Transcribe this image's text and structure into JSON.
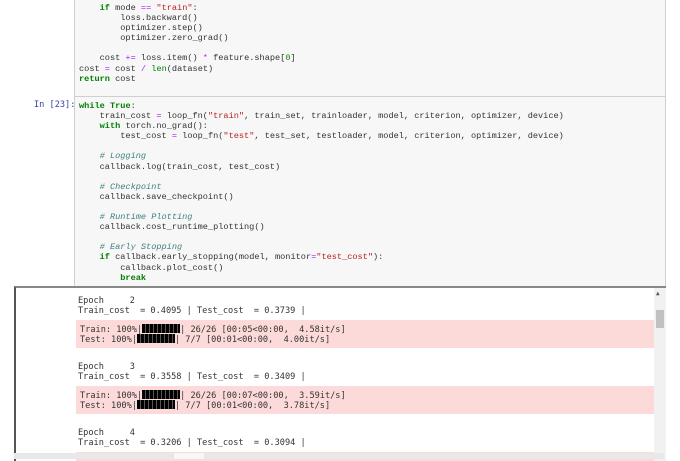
{
  "cell1": {
    "lines": [
      [
        [
          "    ",
          ""
        ],
        [
          "if",
          "kw"
        ],
        [
          " mode ",
          ""
        ],
        [
          "==",
          "op"
        ],
        [
          " ",
          ""
        ],
        [
          "\"train\"",
          "st"
        ],
        [
          ":",
          ""
        ]
      ],
      [
        [
          "        loss.backward()",
          ""
        ]
      ],
      [
        [
          "        optimizer.step()",
          ""
        ]
      ],
      [
        [
          "        optimizer.zero_grad()",
          ""
        ]
      ],
      [
        [
          "",
          ""
        ]
      ],
      [
        [
          "    cost ",
          ""
        ],
        [
          "+=",
          "op"
        ],
        [
          " loss.item() ",
          ""
        ],
        [
          "*",
          "op"
        ],
        [
          " feature.shape[",
          ""
        ],
        [
          "0",
          "nu"
        ],
        [
          "]",
          ""
        ]
      ],
      [
        [
          "cost ",
          ""
        ],
        [
          "=",
          "op"
        ],
        [
          " cost ",
          ""
        ],
        [
          "/",
          "op"
        ],
        [
          " ",
          ""
        ],
        [
          "len",
          "bi"
        ],
        [
          "(dataset)",
          ""
        ]
      ],
      [
        [
          "return",
          "kw"
        ],
        [
          " cost",
          ""
        ]
      ]
    ]
  },
  "cell2": {
    "prompt": "In [23]:",
    "lines": [
      [
        [
          "while",
          "kw"
        ],
        [
          " ",
          ""
        ],
        [
          "True",
          "kw"
        ],
        [
          ":",
          ""
        ]
      ],
      [
        [
          "    train_cost ",
          ""
        ],
        [
          "=",
          "op"
        ],
        [
          " loop_fn(",
          ""
        ],
        [
          "\"train\"",
          "st"
        ],
        [
          ", train_set, trainloader, model, criterion, optimizer, device)",
          ""
        ]
      ],
      [
        [
          "    ",
          ""
        ],
        [
          "with",
          "kw"
        ],
        [
          " torch.no_grad():",
          ""
        ]
      ],
      [
        [
          "        test_cost ",
          ""
        ],
        [
          "=",
          "op"
        ],
        [
          " loop_fn(",
          ""
        ],
        [
          "\"test\"",
          "st"
        ],
        [
          ", test_set, testloader, model, criterion, optimizer, device)",
          ""
        ]
      ],
      [
        [
          "",
          ""
        ]
      ],
      [
        [
          "    ",
          ""
        ],
        [
          "# Logging",
          "cm"
        ]
      ],
      [
        [
          "    callback.log(train_cost, test_cost)",
          ""
        ]
      ],
      [
        [
          "",
          ""
        ]
      ],
      [
        [
          "    ",
          ""
        ],
        [
          "# Checkpoint",
          "cm"
        ]
      ],
      [
        [
          "    callback.save_checkpoint()",
          ""
        ]
      ],
      [
        [
          "",
          ""
        ]
      ],
      [
        [
          "    ",
          ""
        ],
        [
          "# Runtime Plotting",
          "cm"
        ]
      ],
      [
        [
          "    callback.cost_runtime_plotting()",
          ""
        ]
      ],
      [
        [
          "",
          ""
        ]
      ],
      [
        [
          "    ",
          ""
        ],
        [
          "# Early Stopping",
          "cm"
        ]
      ],
      [
        [
          "    ",
          ""
        ],
        [
          "if",
          "kw"
        ],
        [
          " callback.early_stopping(model, monitor",
          ""
        ],
        [
          "=",
          "op"
        ],
        [
          "\"test_cost\"",
          "st"
        ],
        [
          "):",
          ""
        ]
      ],
      [
        [
          "        callback.plot_cost()",
          ""
        ]
      ],
      [
        [
          "        ",
          ""
        ],
        [
          "break",
          "kw"
        ]
      ]
    ]
  },
  "output": {
    "epochs": [
      {
        "epoch": "Epoch     2",
        "cost": "Train_cost  = 0.4095 | Test_cost  = 0.3739 |",
        "train_pre": "Train: 100%|",
        "train_post": "| 26/26 [00:05<00:00,  4.58it/s]",
        "test_pre": "Test: 100%|",
        "test_post": "| 7/7 [00:01<00:00,  4.00it/s]",
        "progress": 1.0
      },
      {
        "epoch": "Epoch     3",
        "cost": "Train_cost  = 0.3558 | Test_cost  = 0.3409 |",
        "train_pre": "Train: 100%|",
        "train_post": "| 26/26 [00:07<00:00,  3.59it/s]",
        "test_pre": "Test: 100%|",
        "test_post": "| 7/7 [00:01<00:00,  3.78it/s]",
        "progress": 1.0
      },
      {
        "epoch": "Epoch     4",
        "cost": "Train_cost  = 0.3206 | Test_cost  = 0.3094 |"
      }
    ]
  }
}
